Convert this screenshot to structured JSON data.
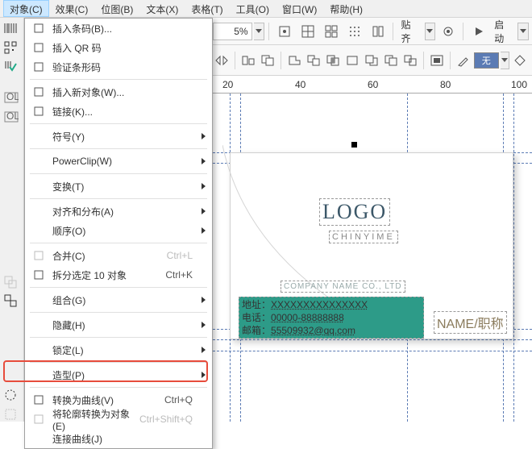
{
  "menu": {
    "items": [
      "对象(C)",
      "效果(C)",
      "位图(B)",
      "文本(X)",
      "表格(T)",
      "工具(O)",
      "窗口(W)",
      "帮助(H)"
    ]
  },
  "dropdown": [
    {
      "ico": "barcode",
      "label": "插入条码(B)..."
    },
    {
      "ico": "qr",
      "label": "插入 QR 码"
    },
    {
      "ico": "barcode-check",
      "label": "验证条形码"
    },
    {
      "sep": true
    },
    {
      "ico": "insert",
      "label": "插入新对象(W)..."
    },
    {
      "ico": "link",
      "label": "链接(K)..."
    },
    {
      "sep": true
    },
    {
      "label": "符号(Y)",
      "sub": true
    },
    {
      "sep": true
    },
    {
      "label": "PowerClip(W)",
      "sub": true
    },
    {
      "sep": true
    },
    {
      "label": "变换(T)",
      "sub": true
    },
    {
      "sep": true
    },
    {
      "label": "对齐和分布(A)",
      "sub": true
    },
    {
      "label": "顺序(O)",
      "sub": true
    },
    {
      "sep": true
    },
    {
      "ico": "combine",
      "label": "合并(C)",
      "short": "Ctrl+L",
      "dis": true
    },
    {
      "ico": "break",
      "label": "拆分选定 10 对象",
      "short": "Ctrl+K"
    },
    {
      "sep": true
    },
    {
      "label": "组合(G)",
      "sub": true
    },
    {
      "sep": true
    },
    {
      "label": "隐藏(H)",
      "sub": true
    },
    {
      "sep": true
    },
    {
      "label": "锁定(L)",
      "sub": true
    },
    {
      "sep": true
    },
    {
      "label": "造型(P)",
      "sub": true
    },
    {
      "sep": true
    },
    {
      "ico": "curve",
      "label": "转换为曲线(V)",
      "short": "Ctrl+Q"
    },
    {
      "ico": "outline",
      "label": "将轮廓转换为对象(E)",
      "short": "Ctrl+Shift+Q",
      "dis": true
    },
    {
      "label": "连接曲线(J)"
    }
  ],
  "toolbar": {
    "pct": "5%",
    "align": "贴齐",
    "start": "启动"
  },
  "toolbar2": {
    "none": "无"
  },
  "ruler": {
    "marks": [
      "20",
      "40",
      "60",
      "80",
      "100"
    ]
  },
  "card": {
    "logo": "LOGO",
    "chinyime": "CHINYIME",
    "company": "COMPANY NAME CO., LTD",
    "addr_l": "地址：",
    "addr_v": "XXXXXXXXXXXXXXX",
    "tel_l": "电话：",
    "tel_v": "00000-88888888",
    "mail_l": "邮箱：",
    "mail_v": "55509932@qq.com",
    "name": "NAME/职称"
  }
}
